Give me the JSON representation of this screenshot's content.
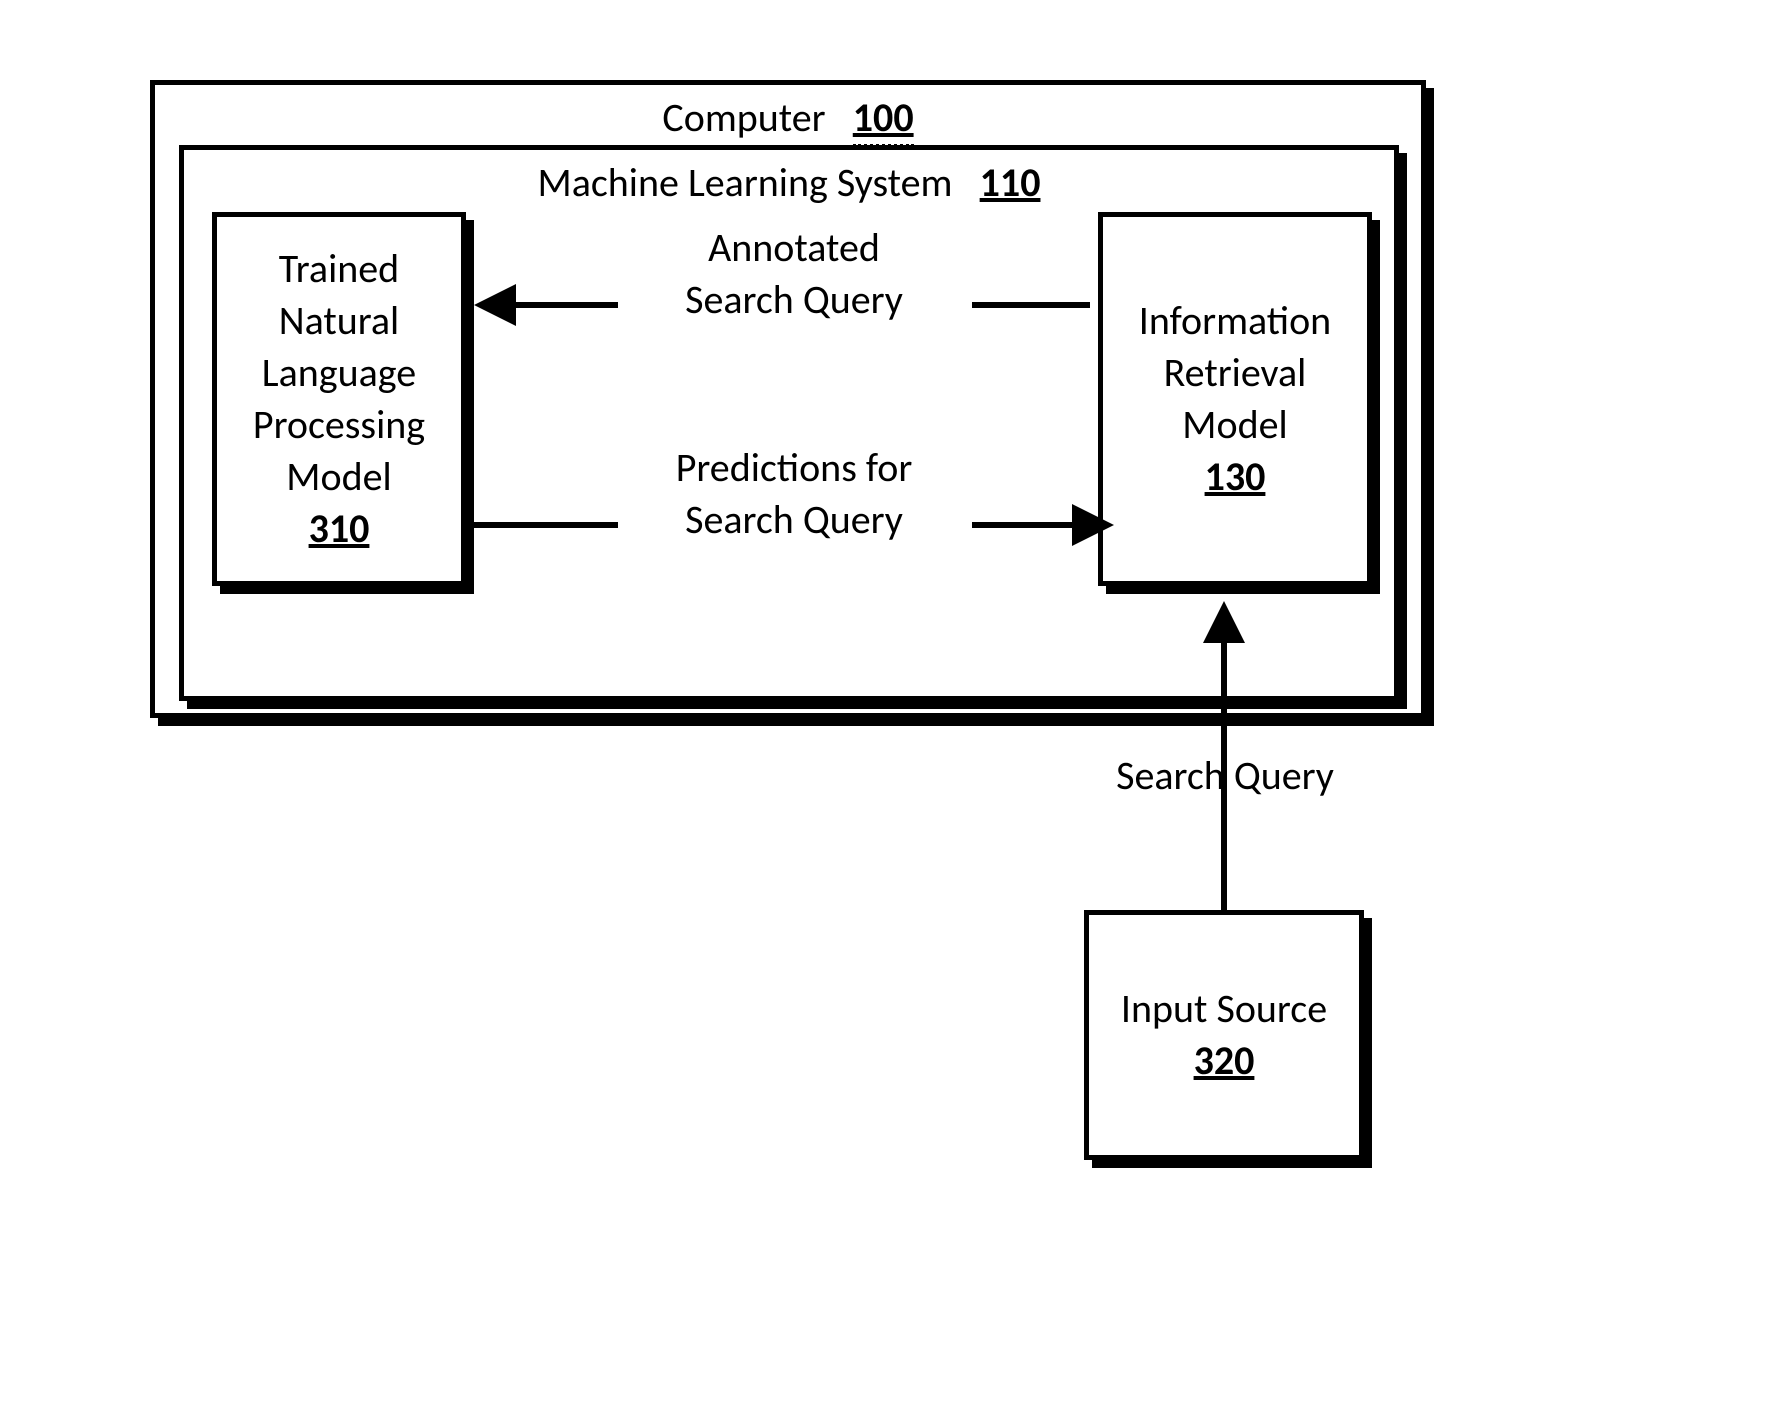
{
  "diagram": {
    "computer": {
      "label": "Computer",
      "ref": "100"
    },
    "ml_system": {
      "label": "Machine Learning System",
      "ref": "110"
    },
    "nlp_model": {
      "label_lines": [
        "Trained",
        "Natural",
        "Language",
        "Processing",
        "Model"
      ],
      "ref": "310"
    },
    "ir_model": {
      "label_lines": [
        "Information",
        "Retrieval",
        "Model"
      ],
      "ref": "130"
    },
    "input_source": {
      "label": "Input Source",
      "ref": "320"
    },
    "edges": {
      "annotated": {
        "label_lines": [
          "Annotated",
          "Search Query"
        ]
      },
      "predictions": {
        "label_lines": [
          "Predictions for",
          "Search Query"
        ]
      },
      "search_query": {
        "label": "Search Query"
      }
    }
  }
}
